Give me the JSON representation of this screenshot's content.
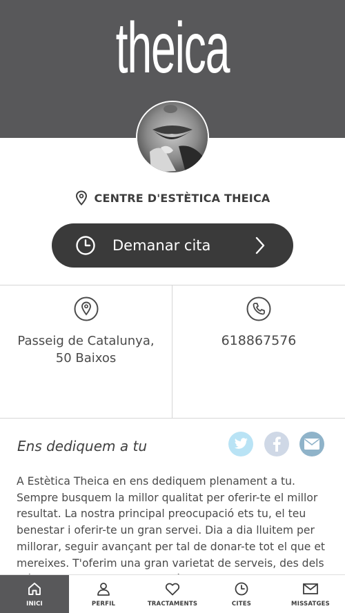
{
  "brand": {
    "logo_text": "theica",
    "header_color": "#58585a",
    "accent_dark": "#3a3a3a"
  },
  "profile": {
    "center_name": "CENTRE D'ESTÈTICA THEICA",
    "pin_icon": "map-pin-icon"
  },
  "cta": {
    "label": "Demanar cita",
    "icon": "clock-icon",
    "arrow": "chevron-right-icon"
  },
  "info": {
    "address_line1": "Passeig de Catalunya,",
    "address_line2": "50 Baixos",
    "address_icon": "location-icon",
    "phone": "618867576",
    "phone_icon": "phone-icon"
  },
  "about": {
    "title": "Ens dediquem a tu",
    "text": "A Estètica Theica en ens dediquem plenament a tu. Sempre busquem la millor qualitat per oferir-te el millor resultat. La nostra principal preocupació ets tu, el teu benestar i oferir-te un gran servei. Dia a dia lluitem per millorar, seguir avançant per tal de donar-te tot el que et mereixes. T'oferim una gran varietat de serveis, des dels mètodes tradicionals fins als últims avenços."
  },
  "social": {
    "twitter": "twitter-icon",
    "facebook": "facebook-icon",
    "mail": "mail-icon"
  },
  "tabs": [
    {
      "label": "INICI",
      "icon": "home-icon"
    },
    {
      "label": "PERFIL",
      "icon": "user-icon"
    },
    {
      "label": "TRACTAMENTS",
      "icon": "heart-icon"
    },
    {
      "label": "CITES",
      "icon": "clock-icon"
    },
    {
      "label": "MISSATGES",
      "icon": "envelope-icon"
    }
  ]
}
